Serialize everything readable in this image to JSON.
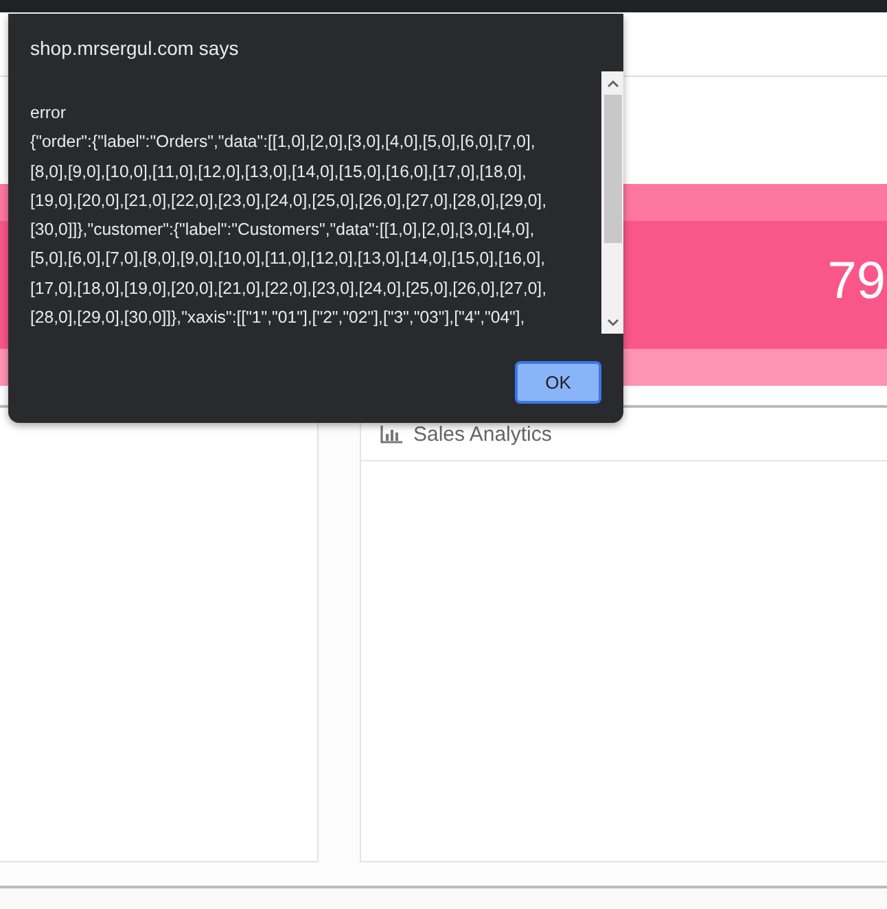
{
  "dialog": {
    "title": "shop.mrsergul.com says",
    "message_lines": [
      "error",
      "{\"order\":{\"label\":\"Orders\",\"data\":[[1,0],[2,0],[3,0],[4,0],[5,0],[6,0],[7,0],",
      "[8,0],[9,0],[10,0],[11,0],[12,0],[13,0],[14,0],[15,0],[16,0],[17,0],[18,0],",
      "[19,0],[20,0],[21,0],[22,0],[23,0],[24,0],[25,0],[26,0],[27,0],[28,0],[29,0],",
      "[30,0]]},\"customer\":{\"label\":\"Customers\",\"data\":[[1,0],[2,0],[3,0],[4,0],",
      "[5,0],[6,0],[7,0],[8,0],[9,0],[10,0],[11,0],[12,0],[13,0],[14,0],[15,0],[16,0],",
      "[17,0],[18,0],[19,0],[20,0],[21,0],[22,0],[23,0],[24,0],[25,0],[26,0],[27,0],",
      "[28,0],[29,0],[30,0]]},\"xaxis\":[[\"1\",\"01\"],[\"2\",\"02\"],[\"3\",\"03\"],[\"4\",\"04\"],"
    ],
    "button": "OK"
  },
  "stat_card": {
    "value": "79"
  },
  "analytics_panel": {
    "title": "Sales Analytics"
  }
}
